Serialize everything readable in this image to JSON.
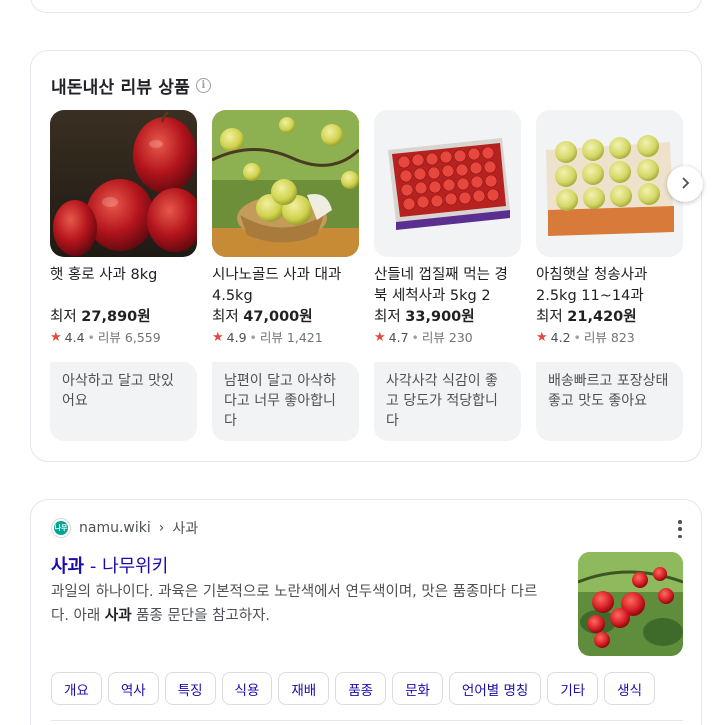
{
  "reviews": {
    "title": "내돈내산 리뷰 상품",
    "products": [
      {
        "name": "햇 홍로 사과 8kg",
        "price_prefix": "최저",
        "price": "27,890원",
        "rating": "4.4",
        "review_count": "리뷰 6,559",
        "review_text": "아삭하고 달고 맛있어요"
      },
      {
        "name": "시나노골드 사과 대과 4.5kg",
        "price_prefix": "최저",
        "price": "47,000원",
        "rating": "4.9",
        "review_count": "리뷰 1,421",
        "review_text": "남편이 달고 아삭하다고 너무 좋아합니다"
      },
      {
        "name": "산들네 껍질째 먹는 경북 세척사과 5kg 2",
        "price_prefix": "최저",
        "price": "33,900원",
        "rating": "4.7",
        "review_count": "리뷰 230",
        "review_text": "사각사각 식감이 좋고 당도가 적당합니다"
      },
      {
        "name": "아침햇살 청송사과 2.5kg 11~14과",
        "price_prefix": "최저",
        "price": "21,420원",
        "rating": "4.2",
        "review_count": "리뷰 823",
        "review_text": "배송빠르고 포장상태 좋고 맛도 좋아요"
      }
    ],
    "next_icon": "chevron-right-icon"
  },
  "wiki": {
    "source": "namu.wiki",
    "breadcrumb_sep": "›",
    "breadcrumb_page": "사과",
    "favicon_text": "나무",
    "title_bold": "사과",
    "title_rest": " - 나무위키",
    "snippet_1": "과일의 하나이다. 과육은 기본적으로 노란색에서 연두색이며, 맛은 품종마다 다르다. 아래 ",
    "snippet_bold": "사과",
    "snippet_2": " 품종 문단을 참고하자.",
    "chips": [
      "개요",
      "역사",
      "특징",
      "식용",
      "재배",
      "품종",
      "문화",
      "언어별 명칭",
      "기타",
      "생식"
    ]
  },
  "colors": {
    "link": "#1a0dab",
    "star": "#e8473e",
    "review_bg": "#f1f3f4"
  }
}
